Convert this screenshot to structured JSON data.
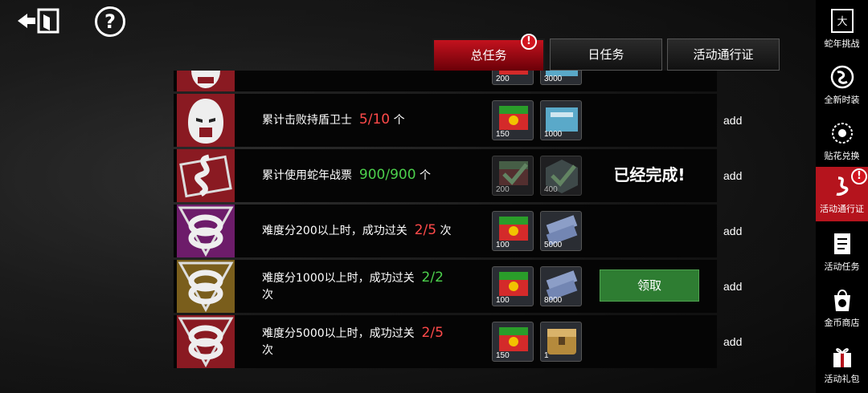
{
  "tabs": [
    {
      "label": "总任务",
      "active": true,
      "badge": "!"
    },
    {
      "label": "日任务",
      "active": false
    },
    {
      "label": "活动通行证",
      "active": false
    }
  ],
  "tasks": [
    {
      "desc_prefix": "",
      "current": "",
      "total": "",
      "unit": "",
      "rewards": [
        {
          "icon": "ticket-icon",
          "qty": "200"
        },
        {
          "icon": "gun-crate-icon",
          "qty": "3000"
        }
      ],
      "status": "add",
      "partial": true
    },
    {
      "desc_prefix": "累计击败持盾卫士",
      "current": "5",
      "total": "10",
      "unit": "个",
      "rewards": [
        {
          "icon": "ticket-icon",
          "qty": "150"
        },
        {
          "icon": "gun-crate-icon",
          "qty": "1000"
        }
      ],
      "status": "add"
    },
    {
      "desc_prefix": "累计使用蛇年战票",
      "current": "900",
      "total": "900",
      "unit": "个",
      "rewards": [
        {
          "icon": "ticket-icon",
          "qty": "200"
        },
        {
          "icon": "cube-icon",
          "qty": "400"
        }
      ],
      "status": "add",
      "done_text": "已经完成!"
    },
    {
      "desc_prefix": "难度分200以上时，成功过关",
      "current": "2",
      "total": "5",
      "unit": "次",
      "rewards": [
        {
          "icon": "ticket-icon",
          "qty": "100"
        },
        {
          "icon": "cash-icon",
          "qty": "5000"
        }
      ],
      "status": "add"
    },
    {
      "desc_prefix": "难度分1000以上时，成功过关",
      "current": "2",
      "total": "2",
      "unit": "次",
      "rewards": [
        {
          "icon": "ticket-icon",
          "qty": "100"
        },
        {
          "icon": "cash-icon",
          "qty": "8000"
        }
      ],
      "status": "add",
      "claim_label": "领取"
    },
    {
      "desc_prefix": "难度分5000以上时，成功过关",
      "current": "2",
      "total": "5",
      "unit": "次",
      "rewards": [
        {
          "icon": "ticket-icon",
          "qty": "150"
        },
        {
          "icon": "chest-icon",
          "qty": "1"
        }
      ],
      "status": "add"
    }
  ],
  "sidebar": [
    {
      "label": "蛇年挑战",
      "icon": "snake-year-icon"
    },
    {
      "label": "全新时装",
      "icon": "costume-icon"
    },
    {
      "label": "贴花兑换",
      "icon": "decal-icon"
    },
    {
      "label": "活动通行证",
      "icon": "pass-icon",
      "active": true,
      "badge": "!"
    },
    {
      "label": "活动任务",
      "icon": "task-icon"
    },
    {
      "label": "金币商店",
      "icon": "shop-icon"
    },
    {
      "label": "活动礼包",
      "icon": "gift-icon"
    }
  ],
  "colors": {
    "accent_red": "#c3121e",
    "progress_red": "#ff4a4a",
    "progress_green": "#4cd04c",
    "claim_green": "#2e7d32"
  }
}
